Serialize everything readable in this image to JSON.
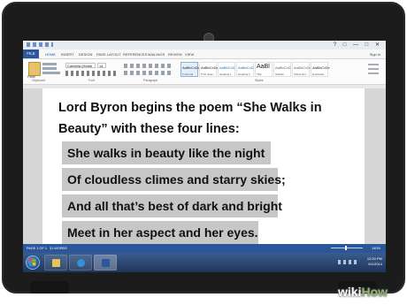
{
  "word": {
    "tabs": [
      "FILE",
      "HOME",
      "INSERT",
      "DESIGN",
      "PAGE LAYOUT",
      "REFERENCES",
      "MAILINGS",
      "REVIEW",
      "VIEW"
    ],
    "active_tab": "HOME",
    "sign_in": "Sign in",
    "font_name": "Cambria (Headi",
    "font_size": "14",
    "paste_label": "Paste",
    "groups": [
      "Clipboard",
      "Font",
      "Paragraph",
      "Styles"
    ],
    "styles": [
      {
        "preview": "AaBbCcDc",
        "name": "¶ Normal"
      },
      {
        "preview": "AaBbCcDc",
        "name": "¶ No Spac..."
      },
      {
        "preview": "AaBbCcD",
        "name": "Heading 1"
      },
      {
        "preview": "AaBbCcD",
        "name": "Heading 2"
      },
      {
        "preview": "AaBl",
        "name": "Title"
      },
      {
        "preview": "AaBbCcD",
        "name": "Subtitle"
      },
      {
        "preview": "AaBbCcDc",
        "name": "Subtle Em..."
      },
      {
        "preview": "AaBbCcDc",
        "name": "Emphasis"
      }
    ],
    "status": {
      "page": "PAGE 1 OF 1",
      "words": "31 WORDS",
      "zoom": "140%"
    }
  },
  "document": {
    "intro": "Lord Byron begins the poem “She Walks in Beauty” with these four lines:",
    "lines": [
      "She walks in beauty like the night",
      "Of cloudless climes and starry skies;",
      "And all that’s best of dark and bright",
      "Meet in her aspect and her eyes."
    ]
  },
  "taskbar": {
    "time": "12:20 PM",
    "date": "6/1/2014"
  },
  "watermark": {
    "wiki": "wiki",
    "how": "How"
  },
  "colors": {
    "word_blue": "#2b579a",
    "highlight_gray": "#c7c7c7"
  }
}
